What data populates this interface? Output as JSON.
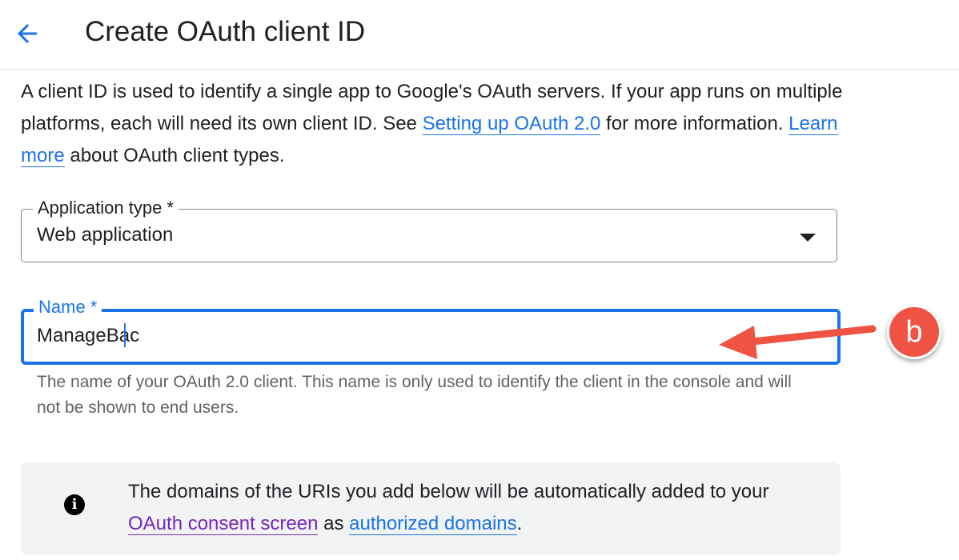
{
  "header": {
    "title": "Create OAuth client ID",
    "back_icon": "arrow-back-icon"
  },
  "intro": {
    "text_1": "A client ID is used to identify a single app to Google's OAuth servers. If your app runs on multiple platforms, each will need its own client ID. See ",
    "link_setup": "Setting up OAuth 2.0",
    "text_2": " for more information. ",
    "link_learn": "Learn more",
    "text_3": " about OAuth client types."
  },
  "application_type": {
    "label": "Application type *",
    "value": "Web application",
    "icon": "dropdown-arrow-icon"
  },
  "name_field": {
    "label": "Name *",
    "value": "ManageBac",
    "helper": "The name of your OAuth 2.0 client. This name is only used to identify the client in the console and will not be shown to end users."
  },
  "annotation": {
    "badge_label": "b",
    "color": "#ee5344"
  },
  "info_box": {
    "icon": "info-icon",
    "text_1": "The domains of the URIs you add below will be automatically added to your ",
    "link_consent": "OAuth consent screen",
    "text_2": " as ",
    "link_domains": "authorized domains",
    "text_3": "."
  },
  "colors": {
    "accent": "#1a73e8",
    "visited_link": "#7627bb",
    "helper_text": "#5f6368"
  }
}
